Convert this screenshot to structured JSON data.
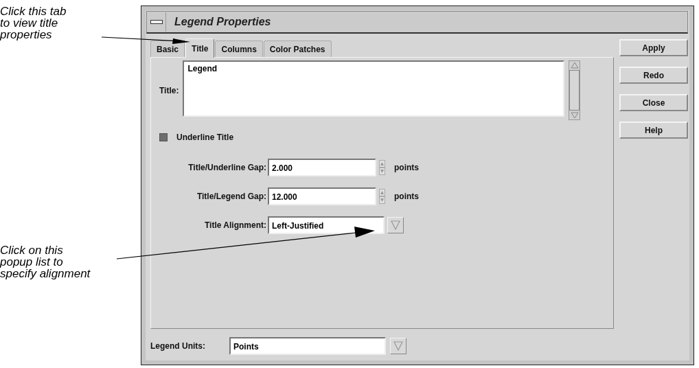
{
  "callouts": [
    {
      "lines": [
        "Click this tab",
        "to view title",
        "properties"
      ]
    },
    {
      "lines": [
        "Click on this",
        "popup list to",
        "specify alignment"
      ]
    }
  ],
  "window": {
    "title": "Legend Properties"
  },
  "tabs": [
    {
      "label": "Basic",
      "selected": false
    },
    {
      "label": "Title",
      "selected": true
    },
    {
      "label": "Columns",
      "selected": false
    },
    {
      "label": "Color Patches",
      "selected": false
    }
  ],
  "title_field": {
    "label": "Title:",
    "value": "Legend"
  },
  "underline_title": {
    "label": "Underline Title",
    "checked": true
  },
  "fields": [
    {
      "kind": "spin",
      "label": "Title/Underline Gap:",
      "value": "2.000",
      "unit": "points"
    },
    {
      "kind": "spin",
      "label": "Title/Legend Gap:",
      "value": "12.000",
      "unit": "points"
    },
    {
      "kind": "dropdown",
      "label": "Title Alignment:",
      "value": "Left-Justified"
    }
  ],
  "legend_units": {
    "label": "Legend Units:",
    "value": "Points"
  },
  "buttons": [
    "Apply",
    "Redo",
    "Close",
    "Help"
  ]
}
